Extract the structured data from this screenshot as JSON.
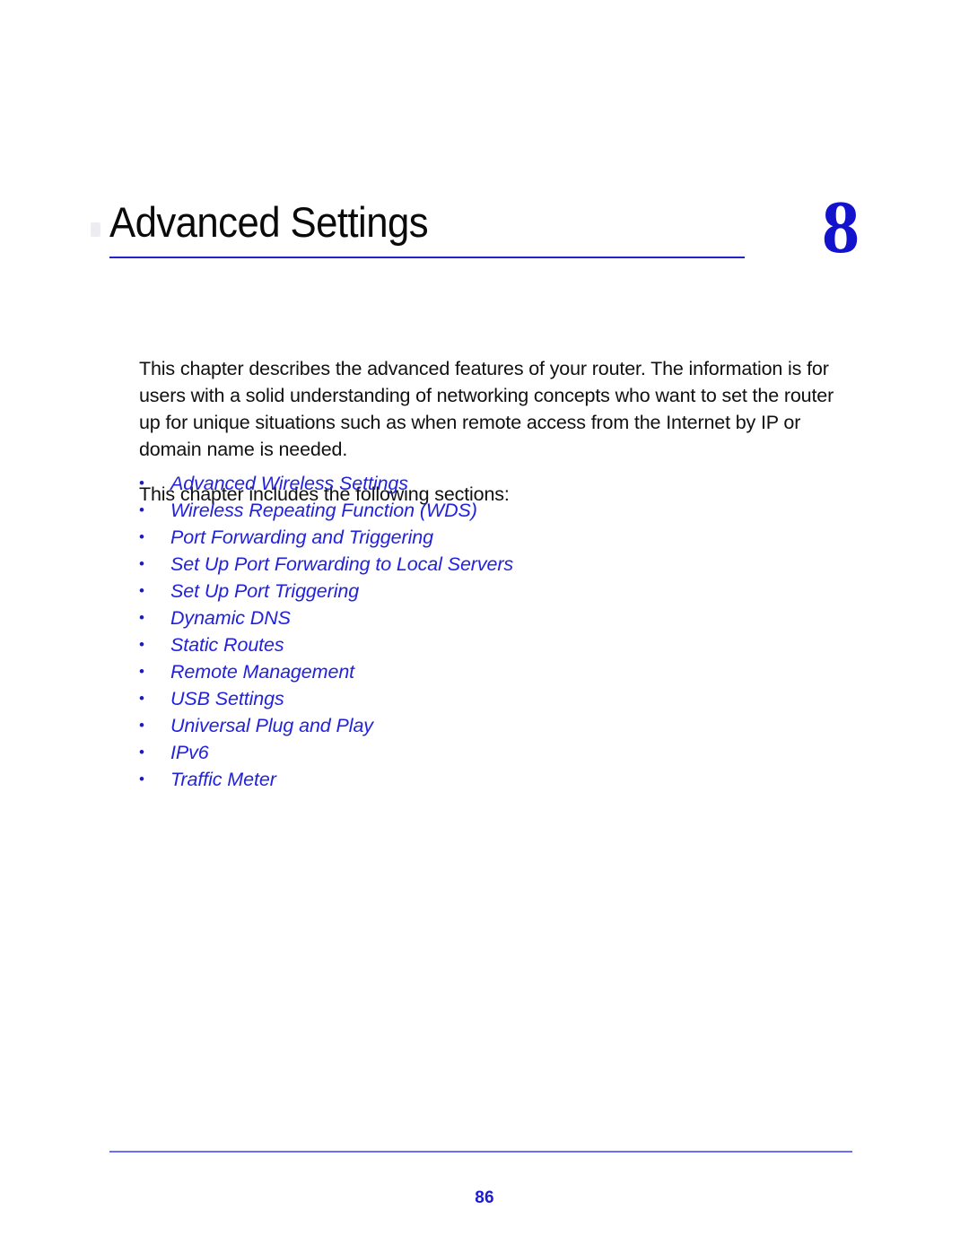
{
  "document": {
    "chapter": {
      "title": "Advanced Settings",
      "number": "8"
    },
    "intro": {
      "paragraph_1": "This chapter describes the advanced features of your router. The information is for users with a solid understanding of networking concepts who want to set the router up for unique situations such as when remote access from the Internet by IP or domain name is needed.",
      "paragraph_2": "This chapter includes the following sections:"
    },
    "bullet_glyph": "•",
    "sections": [
      {
        "label": "Advanced Wireless Settings"
      },
      {
        "label": "Wireless Repeating Function (WDS)"
      },
      {
        "label": "Port Forwarding and Triggering"
      },
      {
        "label": "Set Up Port Forwarding to Local Servers"
      },
      {
        "label": "Set Up Port Triggering"
      },
      {
        "label": "Dynamic DNS"
      },
      {
        "label": "Static Routes"
      },
      {
        "label": "Remote Management"
      },
      {
        "label": "USB Settings"
      },
      {
        "label": "Universal Plug and Play"
      },
      {
        "label": "IPv6"
      },
      {
        "label": "Traffic Meter"
      }
    ],
    "footer": {
      "page_number": "86"
    },
    "colors": {
      "chapter_number": "#1313cd",
      "title_rule": "#2222cc",
      "link": "#2222dd",
      "footer_rule": "#6b6bff",
      "page_number": "#1b1bd4",
      "body_text": "#101010"
    }
  }
}
